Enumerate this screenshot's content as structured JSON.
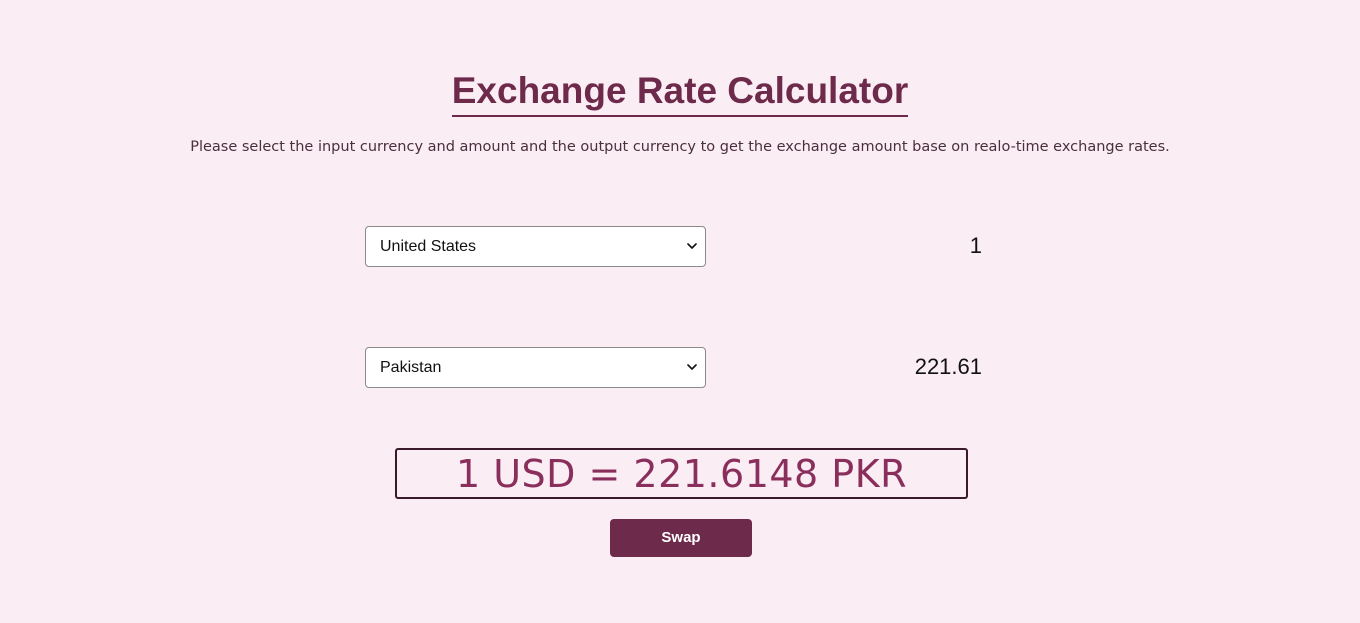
{
  "page": {
    "title": "Exchange Rate Calculator",
    "description": "Please select the input currency and amount and the output currency to get the exchange amount base on realo-time exchange rates."
  },
  "from": {
    "country": "United States",
    "amount": "1"
  },
  "to": {
    "country": "Pakistan",
    "amount": "221.61"
  },
  "rate": {
    "text": "1 USD = 221.6148 PKR"
  },
  "swap_button": {
    "label": "Swap"
  },
  "icons": {
    "select_chevron": "chevron-down-icon"
  },
  "colors": {
    "background": "#fbedf4",
    "accent": "#6e2a4b",
    "rate_text": "#8a2e5c"
  }
}
